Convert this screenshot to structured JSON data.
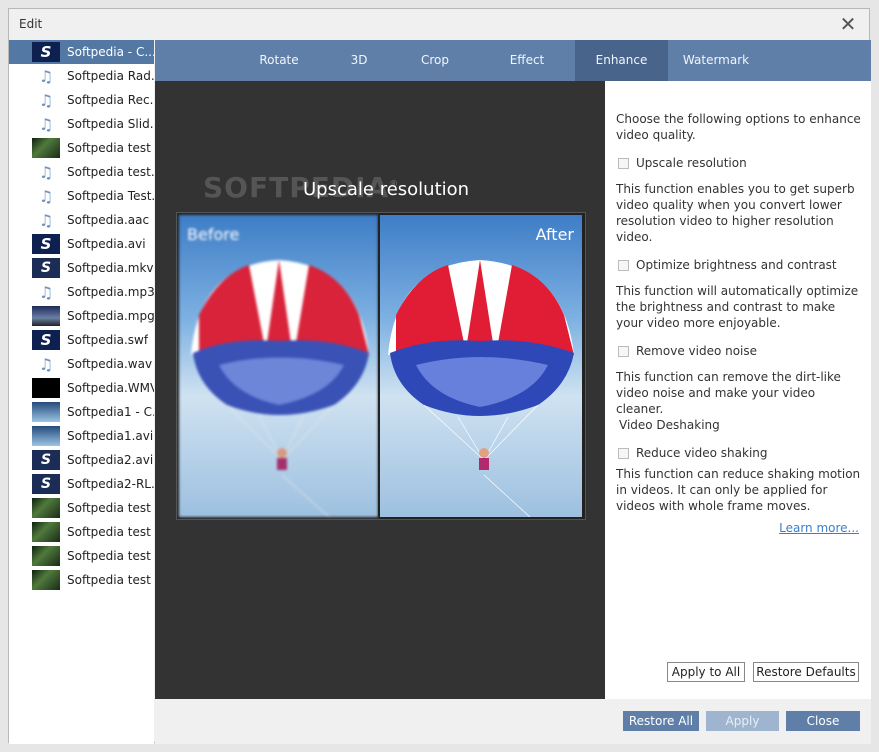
{
  "window": {
    "title": "Edit",
    "close_glyph": "✕"
  },
  "files": [
    {
      "label": "Softpedia - C...",
      "thumb": "s",
      "selected": true
    },
    {
      "label": "Softpedia Rad...",
      "thumb": "music"
    },
    {
      "label": "Softpedia Rec...",
      "thumb": "music"
    },
    {
      "label": "Softpedia Slid...",
      "thumb": "music"
    },
    {
      "label": "Softpedia test ...",
      "thumb": "forest"
    },
    {
      "label": "Softpedia test....",
      "thumb": "music"
    },
    {
      "label": "Softpedia Test....",
      "thumb": "music"
    },
    {
      "label": "Softpedia.aac",
      "thumb": "music"
    },
    {
      "label": "Softpedia.avi",
      "thumb": "s"
    },
    {
      "label": "Softpedia.mkv",
      "thumb": "s2"
    },
    {
      "label": "Softpedia.mp3",
      "thumb": "music"
    },
    {
      "label": "Softpedia.mpg",
      "thumb": "mpg"
    },
    {
      "label": "Softpedia.swf",
      "thumb": "s"
    },
    {
      "label": "Softpedia.wav",
      "thumb": "music"
    },
    {
      "label": "Softpedia.WMV",
      "thumb": "black"
    },
    {
      "label": "Softpedia1 - C...",
      "thumb": "sky"
    },
    {
      "label": "Softpedia1.avi",
      "thumb": "sky"
    },
    {
      "label": "Softpedia2.avi",
      "thumb": "s2"
    },
    {
      "label": "Softpedia2-RL...",
      "thumb": "s2"
    },
    {
      "label": "Softpedia test ...",
      "thumb": "forest"
    },
    {
      "label": "Softpedia test ...",
      "thumb": "forest"
    },
    {
      "label": "Softpedia test ...",
      "thumb": "forest"
    },
    {
      "label": "Softpedia test ...",
      "thumb": "forest"
    }
  ],
  "tabs": [
    "Rotate",
    "3D",
    "Crop",
    "Effect",
    "Enhance",
    "Watermark"
  ],
  "active_tab": "Enhance",
  "preview": {
    "logo": "SOFTPEDIA",
    "logo_mark": "®",
    "heading": "Upscale resolution",
    "before_label": "Before",
    "after_label": "After"
  },
  "panel": {
    "intro": "Choose the following options to enhance video quality.",
    "options": [
      {
        "label": "Upscale resolution",
        "checked": false,
        "desc": "This function enables you to get superb video quality when you convert lower resolution video to higher resolution video."
      },
      {
        "label": "Optimize brightness and contrast",
        "checked": false,
        "desc": "This function will automatically optimize the brightness and contrast to make your video more enjoyable."
      },
      {
        "label": "Remove video noise",
        "checked": false,
        "desc": "This function can remove the dirt-like video noise and make your video cleaner."
      }
    ],
    "deshake_section": "Video Deshaking",
    "deshake_option": {
      "label": "Reduce video shaking",
      "checked": false
    },
    "deshake_desc": "This function can reduce shaking motion in videos. It can only be applied for videos with whole frame moves.",
    "learn_more": "Learn more...",
    "apply_all": "Apply to All",
    "restore_defaults": "Restore Defaults"
  },
  "footer": {
    "restore_all": "Restore All",
    "apply": "Apply",
    "close": "Close"
  },
  "colors": {
    "accent": "#5f7fa8",
    "active_tab": "#48648a",
    "selected_row": "#5478a4",
    "link": "#3a7ed0"
  }
}
